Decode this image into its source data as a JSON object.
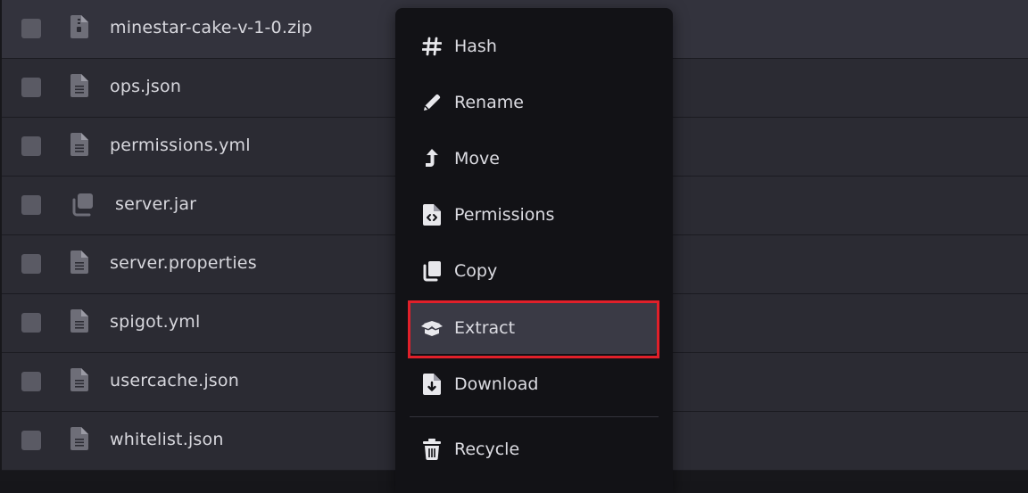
{
  "files": [
    {
      "name": "minestar-cake-v-1-0.zip",
      "icon": "zip-file-icon"
    },
    {
      "name": "ops.json",
      "icon": "file-text-icon"
    },
    {
      "name": "permissions.yml",
      "icon": "file-text-icon"
    },
    {
      "name": "server.jar",
      "icon": "stack-files-icon"
    },
    {
      "name": "server.properties",
      "icon": "file-text-icon"
    },
    {
      "name": "spigot.yml",
      "icon": "file-text-icon"
    },
    {
      "name": "usercache.json",
      "icon": "file-text-icon"
    },
    {
      "name": "whitelist.json",
      "icon": "file-text-icon"
    }
  ],
  "context_menu": {
    "items": [
      {
        "label": "Hash",
        "icon": "hash-icon"
      },
      {
        "label": "Rename",
        "icon": "pencil-icon"
      },
      {
        "label": "Move",
        "icon": "move-arrow-icon"
      },
      {
        "label": "Permissions",
        "icon": "file-code-icon"
      },
      {
        "label": "Copy",
        "icon": "copy-icon"
      },
      {
        "label": "Extract",
        "icon": "box-open-icon",
        "active": true
      },
      {
        "label": "Download",
        "icon": "file-download-icon"
      },
      {
        "label": "Recycle",
        "icon": "trash-icon"
      }
    ]
  },
  "colors": {
    "background": "#17171b",
    "row": "#2b2b33",
    "menu": "#121216",
    "active_item": "#3a3a45",
    "highlight": "#e0202a",
    "text": "#dcdce2"
  }
}
